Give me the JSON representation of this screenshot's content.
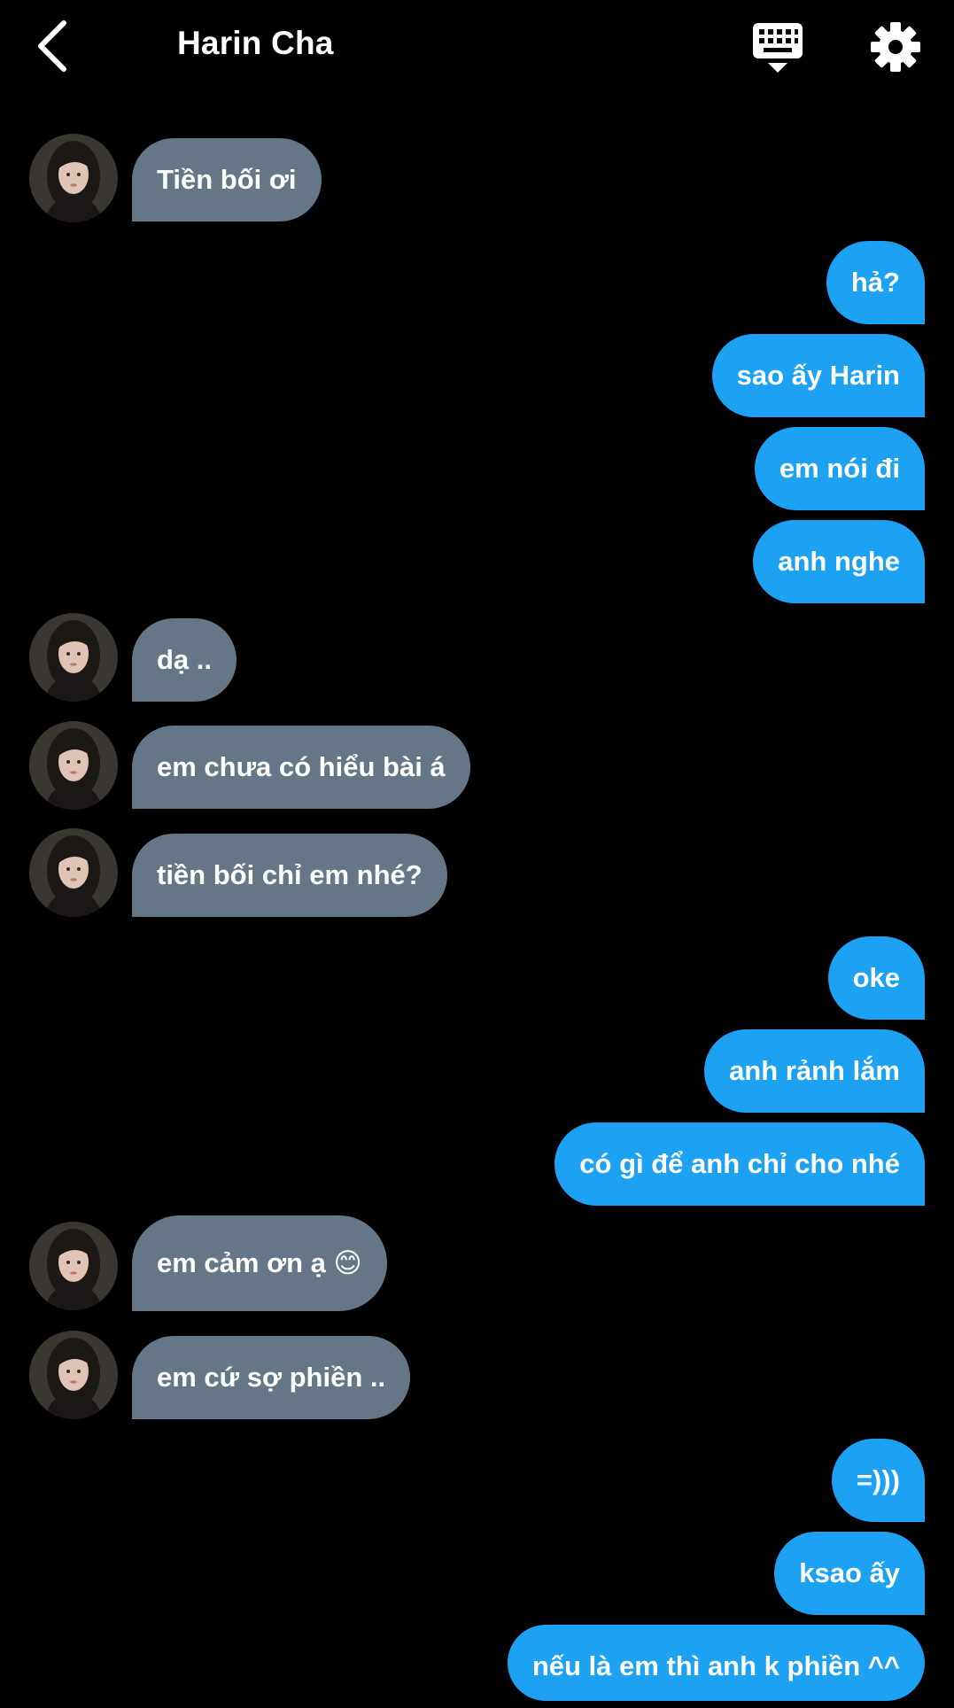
{
  "header": {
    "title": "Harin Cha",
    "back_icon": "chevron-left-icon",
    "keyboard_icon": "keyboard-icon",
    "settings_icon": "gear-icon"
  },
  "colors": {
    "background": "#000000",
    "incoming_bubble": "#657786",
    "outgoing_bubble": "#1da1f2",
    "text": "#ffffff"
  },
  "messages": [
    {
      "from": "Harin Cha",
      "text": "Tiền bối ơi"
    },
    {
      "from": "me",
      "text": "hả?"
    },
    {
      "from": "me",
      "text": "sao ấy Harin"
    },
    {
      "from": "me",
      "text": "em nói đi"
    },
    {
      "from": "me",
      "text": "anh nghe"
    },
    {
      "from": "Harin Cha",
      "text": "dạ .."
    },
    {
      "from": "Harin Cha",
      "text": "em chưa có hiểu bài á"
    },
    {
      "from": "Harin Cha",
      "text": "tiền bối chỉ em nhé?"
    },
    {
      "from": "me",
      "text": "oke"
    },
    {
      "from": "me",
      "text": "anh rảnh lắm"
    },
    {
      "from": "me",
      "text": "có gì để anh chỉ cho nhé"
    },
    {
      "from": "Harin Cha",
      "text": "em cảm ơn ạ 😊"
    },
    {
      "from": "Harin Cha",
      "text": "em cứ sợ phiền .."
    },
    {
      "from": "me",
      "text": "=)))"
    },
    {
      "from": "me",
      "text": "ksao ấy"
    },
    {
      "from": "me",
      "text": "nếu là em thì anh k phiền ^^"
    }
  ]
}
